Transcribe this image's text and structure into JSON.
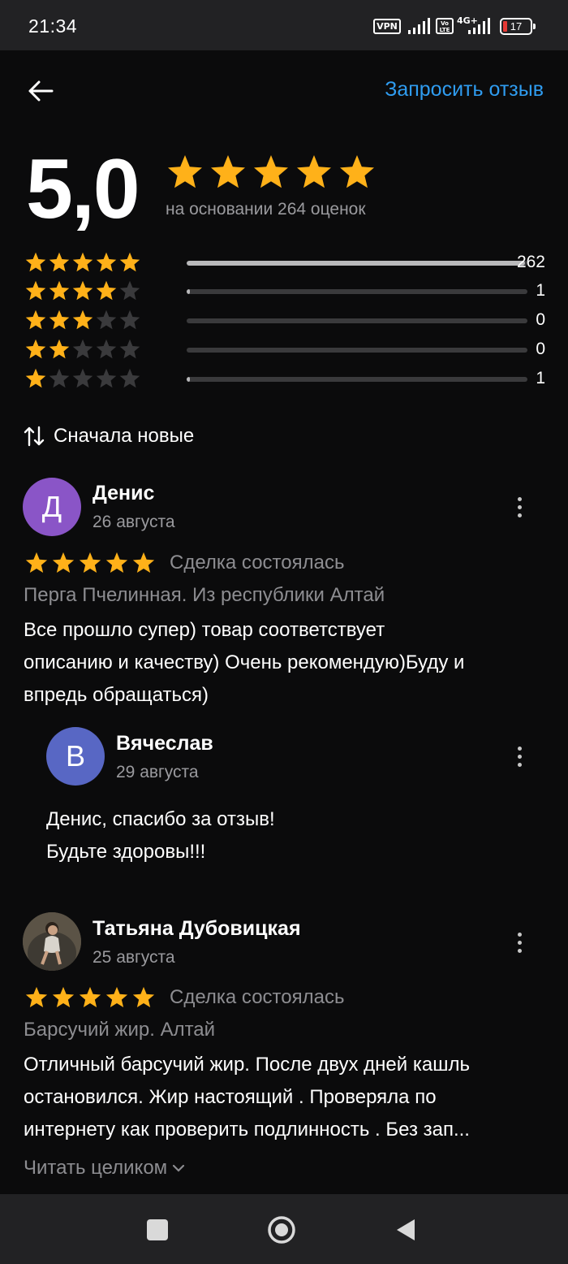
{
  "status_bar": {
    "time": "21:34",
    "vpn": "VPN",
    "volte": "Vo LTE",
    "network": "4G+",
    "battery": "17"
  },
  "header": {
    "back_icon": "arrow-left-icon",
    "request_review": "Запросить отзыв"
  },
  "summary": {
    "score": "5,0",
    "stars": 5,
    "based_on": "на основании 264 оценок"
  },
  "distribution": [
    {
      "stars": 5,
      "count": "262",
      "fraction": 0.992
    },
    {
      "stars": 4,
      "count": "1",
      "fraction": 0.004
    },
    {
      "stars": 3,
      "count": "0",
      "fraction": 0.0
    },
    {
      "stars": 2,
      "count": "0",
      "fraction": 0.0
    },
    {
      "stars": 1,
      "count": "1",
      "fraction": 0.004
    }
  ],
  "sort": {
    "icon": "sort-arrows-icon",
    "label": "Сначала новые"
  },
  "reviews": [
    {
      "initial": "Д",
      "avatar_color": "#8a55c7",
      "author": "Денис",
      "date": "26 августа",
      "rating": 5,
      "status": "Сделка состоялась",
      "product": "Перга Пчелинная. Из республики Алтай",
      "text_lines": [
        "Все прошло супер) товар соответствует",
        "описанию и качеству) Очень рекомендую)Буду и",
        "впредь обращаться)"
      ],
      "reply": {
        "initial": "В",
        "avatar_color": "#5867c4",
        "author": "Вячеслав",
        "date": "29 августа",
        "text_lines": [
          "Денис, спасибо за отзыв!",
          "Будьте здоровы!!!"
        ]
      }
    },
    {
      "avatar_icon": "user-photo-avatar",
      "author": "Татьяна Дубовицкая",
      "date": "25 августа",
      "rating": 5,
      "status": "Сделка состоялась",
      "product": "Барсучий жир. Алтай",
      "text_lines": [
        "Отличный барсучий жир. После двух дней кашль",
        "остановился. Жир настоящий . Проверяла по",
        "интернету как проверить подлинность . Без зап..."
      ],
      "read_more": "Читать целиком"
    }
  ],
  "colors": {
    "background": "#0b0b0c",
    "star_gold": "#ffb119",
    "star_empty": "#3a3a3c",
    "link_blue": "#2f9cf0",
    "muted_text": "#8d8d91"
  },
  "nav_bar": {
    "recents_icon": "square-recents-icon",
    "home_icon": "circle-home-icon",
    "back_icon": "triangle-back-icon"
  }
}
